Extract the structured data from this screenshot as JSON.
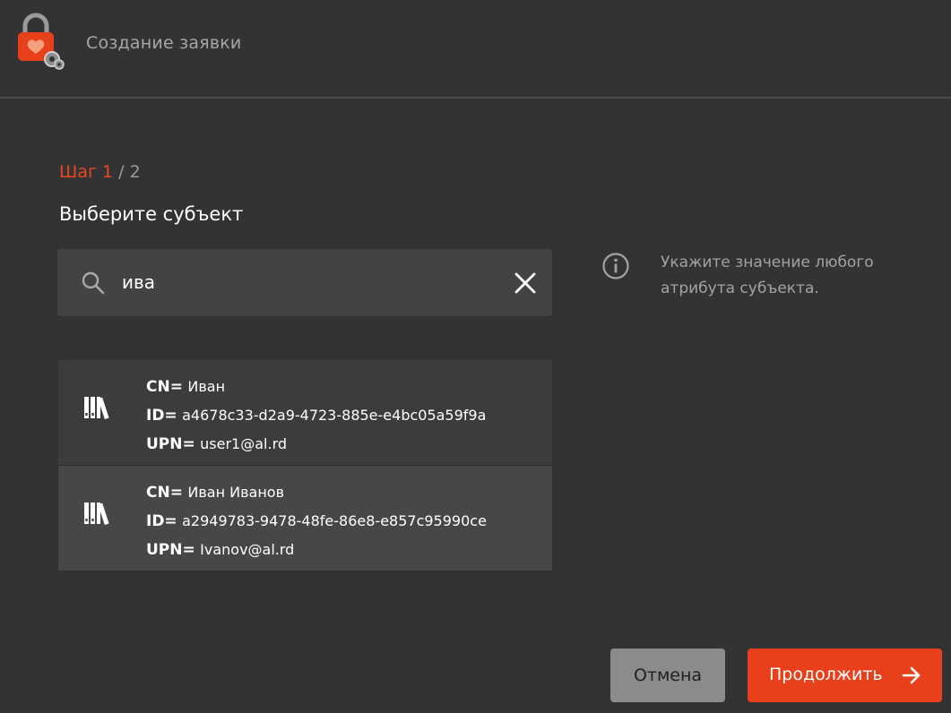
{
  "header": {
    "title": "Создание заявки",
    "logo_icon": "lock-heart-gears-icon"
  },
  "step": {
    "label": "Шаг 1",
    "total": "/ 2"
  },
  "page": {
    "subtitle": "Выберите субъект"
  },
  "search": {
    "value": "ива",
    "icon": "search-icon"
  },
  "hint": {
    "icon": "info-icon",
    "line1": "Укажите значение любого",
    "line2": "атрибута субъекта."
  },
  "results": [
    {
      "cn_label": "CN=",
      "cn": "Иван",
      "id_label": "ID=",
      "id": "a4678c33-d2a9-4723-885e-e4bc05a59f9a",
      "upn_label": "UPN=",
      "upn": "user1@al.rd"
    },
    {
      "cn_label": "CN=",
      "cn": "Иван Иванов",
      "id_label": "ID=",
      "id": "a2949783-9478-48fe-86e8-e857c95990ce",
      "upn_label": "UPN=",
      "upn": "Ivanov@al.rd"
    }
  ],
  "buttons": {
    "cancel": "Отмена",
    "continue": "Продолжить"
  },
  "colors": {
    "background": "#333335",
    "accent": "#e8401a",
    "panel": "#434345"
  }
}
